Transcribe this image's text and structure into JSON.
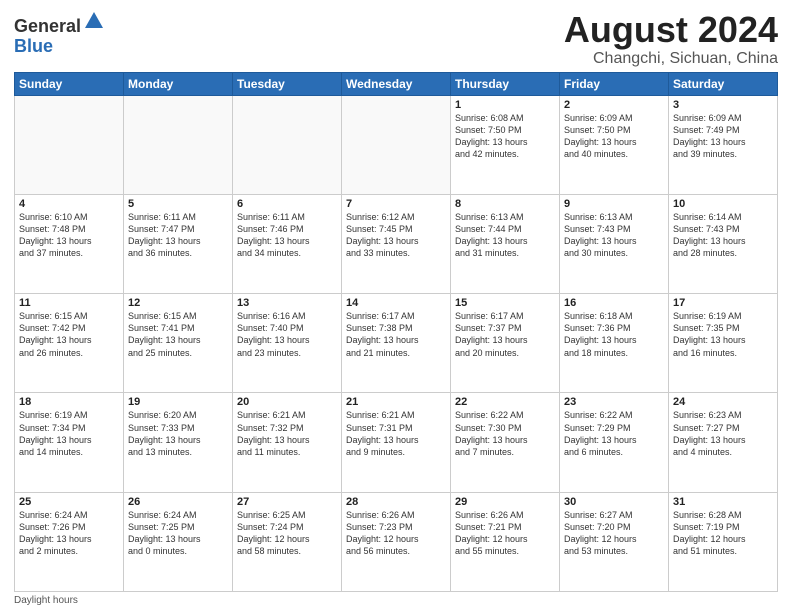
{
  "logo": {
    "line1": "General",
    "line2": "Blue"
  },
  "title": {
    "month_year": "August 2024",
    "location": "Changchi, Sichuan, China"
  },
  "days_of_week": [
    "Sunday",
    "Monday",
    "Tuesday",
    "Wednesday",
    "Thursday",
    "Friday",
    "Saturday"
  ],
  "footer": {
    "note": "Daylight hours"
  },
  "weeks": [
    [
      {
        "day": "",
        "info": ""
      },
      {
        "day": "",
        "info": ""
      },
      {
        "day": "",
        "info": ""
      },
      {
        "day": "",
        "info": ""
      },
      {
        "day": "1",
        "info": "Sunrise: 6:08 AM\nSunset: 7:50 PM\nDaylight: 13 hours\nand 42 minutes."
      },
      {
        "day": "2",
        "info": "Sunrise: 6:09 AM\nSunset: 7:50 PM\nDaylight: 13 hours\nand 40 minutes."
      },
      {
        "day": "3",
        "info": "Sunrise: 6:09 AM\nSunset: 7:49 PM\nDaylight: 13 hours\nand 39 minutes."
      }
    ],
    [
      {
        "day": "4",
        "info": "Sunrise: 6:10 AM\nSunset: 7:48 PM\nDaylight: 13 hours\nand 37 minutes."
      },
      {
        "day": "5",
        "info": "Sunrise: 6:11 AM\nSunset: 7:47 PM\nDaylight: 13 hours\nand 36 minutes."
      },
      {
        "day": "6",
        "info": "Sunrise: 6:11 AM\nSunset: 7:46 PM\nDaylight: 13 hours\nand 34 minutes."
      },
      {
        "day": "7",
        "info": "Sunrise: 6:12 AM\nSunset: 7:45 PM\nDaylight: 13 hours\nand 33 minutes."
      },
      {
        "day": "8",
        "info": "Sunrise: 6:13 AM\nSunset: 7:44 PM\nDaylight: 13 hours\nand 31 minutes."
      },
      {
        "day": "9",
        "info": "Sunrise: 6:13 AM\nSunset: 7:43 PM\nDaylight: 13 hours\nand 30 minutes."
      },
      {
        "day": "10",
        "info": "Sunrise: 6:14 AM\nSunset: 7:43 PM\nDaylight: 13 hours\nand 28 minutes."
      }
    ],
    [
      {
        "day": "11",
        "info": "Sunrise: 6:15 AM\nSunset: 7:42 PM\nDaylight: 13 hours\nand 26 minutes."
      },
      {
        "day": "12",
        "info": "Sunrise: 6:15 AM\nSunset: 7:41 PM\nDaylight: 13 hours\nand 25 minutes."
      },
      {
        "day": "13",
        "info": "Sunrise: 6:16 AM\nSunset: 7:40 PM\nDaylight: 13 hours\nand 23 minutes."
      },
      {
        "day": "14",
        "info": "Sunrise: 6:17 AM\nSunset: 7:38 PM\nDaylight: 13 hours\nand 21 minutes."
      },
      {
        "day": "15",
        "info": "Sunrise: 6:17 AM\nSunset: 7:37 PM\nDaylight: 13 hours\nand 20 minutes."
      },
      {
        "day": "16",
        "info": "Sunrise: 6:18 AM\nSunset: 7:36 PM\nDaylight: 13 hours\nand 18 minutes."
      },
      {
        "day": "17",
        "info": "Sunrise: 6:19 AM\nSunset: 7:35 PM\nDaylight: 13 hours\nand 16 minutes."
      }
    ],
    [
      {
        "day": "18",
        "info": "Sunrise: 6:19 AM\nSunset: 7:34 PM\nDaylight: 13 hours\nand 14 minutes."
      },
      {
        "day": "19",
        "info": "Sunrise: 6:20 AM\nSunset: 7:33 PM\nDaylight: 13 hours\nand 13 minutes."
      },
      {
        "day": "20",
        "info": "Sunrise: 6:21 AM\nSunset: 7:32 PM\nDaylight: 13 hours\nand 11 minutes."
      },
      {
        "day": "21",
        "info": "Sunrise: 6:21 AM\nSunset: 7:31 PM\nDaylight: 13 hours\nand 9 minutes."
      },
      {
        "day": "22",
        "info": "Sunrise: 6:22 AM\nSunset: 7:30 PM\nDaylight: 13 hours\nand 7 minutes."
      },
      {
        "day": "23",
        "info": "Sunrise: 6:22 AM\nSunset: 7:29 PM\nDaylight: 13 hours\nand 6 minutes."
      },
      {
        "day": "24",
        "info": "Sunrise: 6:23 AM\nSunset: 7:27 PM\nDaylight: 13 hours\nand 4 minutes."
      }
    ],
    [
      {
        "day": "25",
        "info": "Sunrise: 6:24 AM\nSunset: 7:26 PM\nDaylight: 13 hours\nand 2 minutes."
      },
      {
        "day": "26",
        "info": "Sunrise: 6:24 AM\nSunset: 7:25 PM\nDaylight: 13 hours\nand 0 minutes."
      },
      {
        "day": "27",
        "info": "Sunrise: 6:25 AM\nSunset: 7:24 PM\nDaylight: 12 hours\nand 58 minutes."
      },
      {
        "day": "28",
        "info": "Sunrise: 6:26 AM\nSunset: 7:23 PM\nDaylight: 12 hours\nand 56 minutes."
      },
      {
        "day": "29",
        "info": "Sunrise: 6:26 AM\nSunset: 7:21 PM\nDaylight: 12 hours\nand 55 minutes."
      },
      {
        "day": "30",
        "info": "Sunrise: 6:27 AM\nSunset: 7:20 PM\nDaylight: 12 hours\nand 53 minutes."
      },
      {
        "day": "31",
        "info": "Sunrise: 6:28 AM\nSunset: 7:19 PM\nDaylight: 12 hours\nand 51 minutes."
      }
    ]
  ]
}
